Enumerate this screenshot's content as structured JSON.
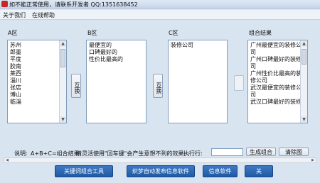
{
  "titlebar": {
    "title": "如不能正常使用，请联系开发者 QQ:1351638452"
  },
  "menu": {
    "items": [
      "关于我们",
      "在线帮助"
    ]
  },
  "panels": {
    "a": {
      "label": "A区",
      "lines": [
        "苏州",
        "郎墨",
        "平度",
        "胶南",
        "莱西",
        "淄川",
        "张店",
        "博山",
        "临淄"
      ]
    },
    "b": {
      "label": "B区",
      "lines": [
        "最便宜的",
        "口碑最好的",
        "性价比最高的"
      ]
    },
    "c": {
      "label": "C区",
      "lines": [
        "装修公司"
      ]
    },
    "result": {
      "label": "组合结果",
      "lines": [
        "广州最便宜的装修公",
        "司",
        "广州口碑最好的装修公",
        "司",
        "广州性价比最高的装",
        "修公司",
        "武汉最便宜的装修公",
        "司",
        "武汉口碑最好的装修公"
      ]
    }
  },
  "swap_label": "互换",
  "bottom": {
    "note_label": "说明:",
    "note_formula": "A+B+C=组合结果",
    "note_tip": "请灵活使用\"回车键\"会产生意想不到的效果",
    "exec_label": "执行行:",
    "exec_value": "",
    "btn_generate": "生成组合",
    "btn_clear": "清除图"
  },
  "actions": [
    "关键词组合工具",
    "织梦自动发布信息软件",
    "信息软件",
    "关"
  ]
}
